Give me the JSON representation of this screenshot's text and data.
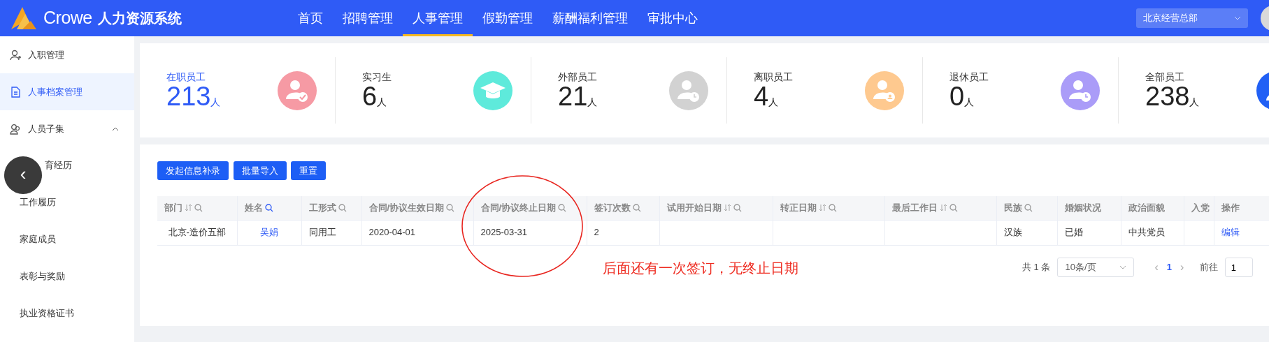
{
  "header": {
    "brand": "Crowe",
    "system_name": "人力资源系统",
    "nav": [
      {
        "label": "首页",
        "selected": false
      },
      {
        "label": "招聘管理",
        "selected": false
      },
      {
        "label": "人事管理",
        "selected": true
      },
      {
        "label": "假勤管理",
        "selected": false
      },
      {
        "label": "薪酬福利管理",
        "selected": false
      },
      {
        "label": "审批中心",
        "selected": false
      }
    ],
    "org_select": {
      "value": "北京经营总部"
    }
  },
  "sidebar": {
    "items": [
      {
        "label": "入职管理",
        "kind": "user",
        "selected": false
      },
      {
        "label": "人事档案管理",
        "kind": "doc",
        "selected": true
      },
      {
        "label": "人员子集",
        "kind": "group",
        "selected": false,
        "expanded": true,
        "children": [
          {
            "label": "育经历",
            "selected": false
          },
          {
            "label": "工作履历",
            "selected": false
          },
          {
            "label": "家庭成员",
            "selected": false
          },
          {
            "label": "表彰与奖励",
            "selected": false
          },
          {
            "label": "执业资格证书",
            "selected": false
          }
        ]
      }
    ],
    "collapse_button": "‹"
  },
  "stats": [
    {
      "label": "在职员工",
      "value": "213",
      "unit": "人",
      "selected": true,
      "kind": "check",
      "color": "#f69aa4"
    },
    {
      "label": "实习生",
      "value": "6",
      "unit": "人",
      "selected": false,
      "kind": "cap",
      "color": "#5eeadb"
    },
    {
      "label": "外部员工",
      "value": "21",
      "unit": "人",
      "selected": false,
      "kind": "clock",
      "color": "#d2d2d2"
    },
    {
      "label": "离职员工",
      "value": "4",
      "unit": "人",
      "selected": false,
      "kind": "badge",
      "color": "#fec98f"
    },
    {
      "label": "退休员工",
      "value": "0",
      "unit": "人",
      "selected": false,
      "kind": "clock",
      "color": "#aa9cf8"
    },
    {
      "label": "全部员工",
      "value": "238",
      "unit": "人",
      "selected": false,
      "kind": "user",
      "color": "#2160f5"
    }
  ],
  "buttons": [
    "发起信息补录",
    "批量导入",
    "重置"
  ],
  "table": {
    "columns": [
      {
        "label": "部门",
        "sortable": true,
        "searchable": true,
        "filtered": false
      },
      {
        "label": "姓名",
        "sortable": false,
        "searchable": true,
        "filtered": true
      },
      {
        "label": "工形式",
        "sortable": false,
        "searchable": true,
        "filtered": false
      },
      {
        "label": "合同/协议生效日期",
        "sortable": false,
        "searchable": true,
        "filtered": false
      },
      {
        "label": "合同/协议终止日期",
        "sortable": false,
        "searchable": true,
        "filtered": false
      },
      {
        "label": "签订次数",
        "sortable": false,
        "searchable": true,
        "filtered": false
      },
      {
        "label": "试用开始日期",
        "sortable": true,
        "searchable": true,
        "filtered": false
      },
      {
        "label": "转正日期",
        "sortable": true,
        "searchable": true,
        "filtered": false
      },
      {
        "label": "最后工作日",
        "sortable": true,
        "searchable": true,
        "filtered": false
      },
      {
        "label": "民族",
        "sortable": false,
        "searchable": true,
        "filtered": false
      },
      {
        "label": "婚姻状况",
        "sortable": false,
        "searchable": false
      },
      {
        "label": "政治面貌",
        "sortable": false,
        "searchable": false
      },
      {
        "label": "入党",
        "sortable": false,
        "searchable": false
      },
      {
        "label": "操作",
        "sortable": false,
        "searchable": false
      }
    ],
    "rows": [
      [
        {
          "text": "北京-造价五部",
          "kind": "text"
        },
        {
          "text": "吴娟",
          "kind": "link"
        },
        {
          "text": "同用工",
          "kind": "text"
        },
        {
          "text": "2020-04-01",
          "kind": "text"
        },
        {
          "text": "2025-03-31",
          "kind": "text"
        },
        {
          "text": "2",
          "kind": "text"
        },
        null,
        null,
        null,
        {
          "text": "汉族",
          "kind": "text"
        },
        {
          "text": "已婚",
          "kind": "text"
        },
        {
          "text": "中共党员",
          "kind": "text"
        },
        null,
        {
          "text": "编辑",
          "kind": "link"
        }
      ]
    ]
  },
  "annotation": {
    "text": "后面还有一次签订，无终止日期"
  },
  "pagination": {
    "total": "共 1 条",
    "page_size": "10条/页",
    "prev": "‹",
    "pages": [
      {
        "label": "1",
        "selected": true
      }
    ],
    "next": "›",
    "goto_label": "前往",
    "goto_value": "1"
  }
}
